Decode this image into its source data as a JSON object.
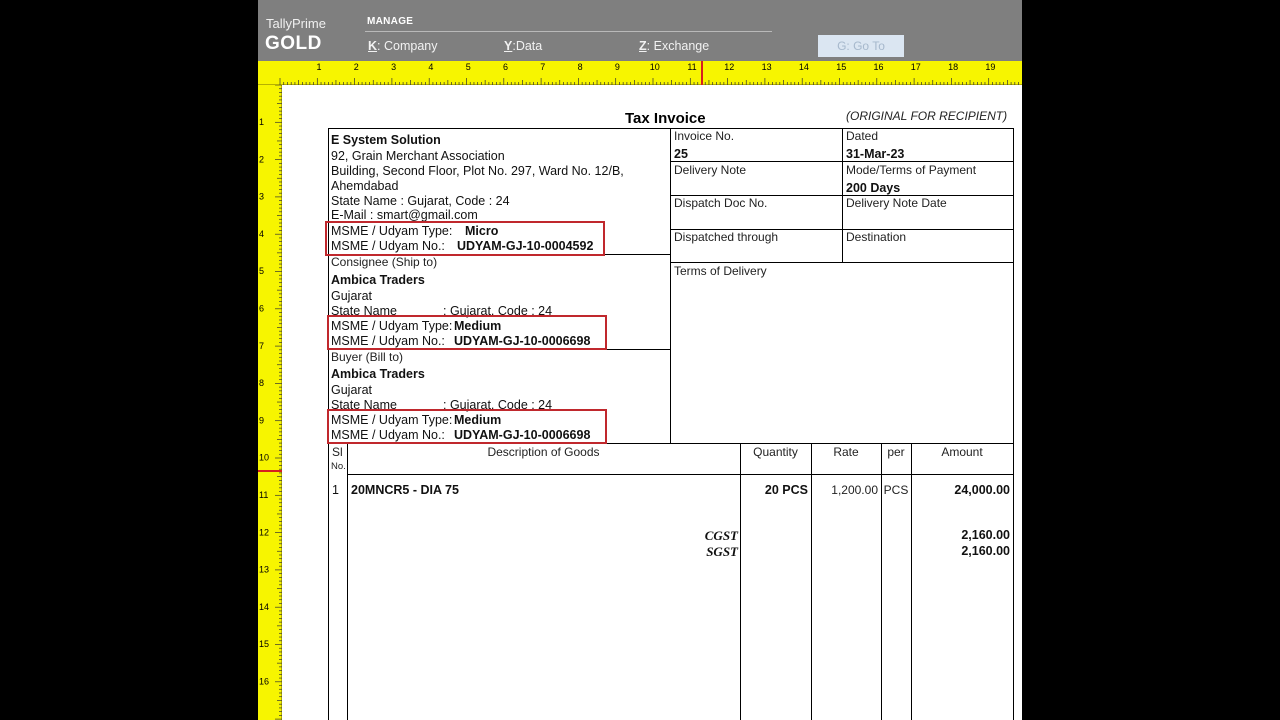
{
  "topbar": {
    "brand_top": "TallyPrime",
    "brand_bottom": "GOLD",
    "section": "MANAGE",
    "menu": [
      {
        "key": "K",
        "label": "Company"
      },
      {
        "key": "Y",
        "label": "Data"
      },
      {
        "key": "Z",
        "label": "Exchange"
      }
    ],
    "goto": "G: Go To"
  },
  "ruler": {
    "h_numbers": [
      "1",
      "2",
      "3",
      "4",
      "5",
      "6",
      "7",
      "8",
      "9",
      "10",
      "11",
      "12",
      "13",
      "14",
      "15",
      "16",
      "17",
      "18",
      "19"
    ],
    "v_numbers": [
      "1",
      "2",
      "3",
      "4",
      "5",
      "6",
      "7",
      "8",
      "9",
      "10",
      "11",
      "12",
      "13",
      "14",
      "15",
      "16"
    ]
  },
  "invoice": {
    "title": "Tax Invoice",
    "copy_label": "(ORIGINAL FOR RECIPIENT)",
    "seller": {
      "name": "E System Solution",
      "addr1": "92, Grain Merchant Association",
      "addr2": "Building, Second Floor, Plot No. 297, Ward No. 12/B,",
      "addr3": "Ahemdabad",
      "state": "State Name :  Gujarat, Code : 24",
      "email": "E-Mail : smart@gmail.com",
      "msme_type_label": "MSME / Udyam Type:",
      "msme_type": "Micro",
      "msme_no_label": "MSME / Udyam No.:",
      "msme_no": "UDYAM-GJ-10-0004592"
    },
    "consignee": {
      "heading": "Consignee (Ship to)",
      "name": "Ambica Traders",
      "addr": "Gujarat",
      "state_label": "State Name",
      "state_value": ":  Gujarat, Code : 24",
      "msme_type_label": "MSME / Udyam Type:",
      "msme_type": "Medium",
      "msme_no_label": "MSME / Udyam No.:",
      "msme_no": "UDYAM-GJ-10-0006698"
    },
    "buyer": {
      "heading": "Buyer (Bill to)",
      "name": "Ambica Traders",
      "addr": "Gujarat",
      "state_label": "State Name",
      "state_value": ":  Gujarat, Code : 24",
      "msme_type_label": "MSME / Udyam Type:",
      "msme_type": "Medium",
      "msme_no_label": "MSME / Udyam No.:",
      "msme_no": "UDYAM-GJ-10-0006698"
    },
    "meta": {
      "invoice_no_label": "Invoice No.",
      "invoice_no": "25",
      "dated_label": "Dated",
      "dated": "31-Mar-23",
      "delivery_note_label": "Delivery Note",
      "terms_payment_label": "Mode/Terms of Payment",
      "terms_payment": "200 Days",
      "dispatch_doc_label": "Dispatch Doc No.",
      "delivery_note_date_label": "Delivery Note Date",
      "dispatched_through_label": "Dispatched through",
      "destination_label": "Destination",
      "terms_delivery_label": "Terms of Delivery"
    },
    "table": {
      "headers": {
        "sl1": "Sl",
        "sl2": "No.",
        "description": "Description of Goods",
        "quantity": "Quantity",
        "rate": "Rate",
        "per": "per",
        "amount": "Amount"
      },
      "rows": [
        {
          "sl": "1",
          "description": "20MNCR5 - DIA 75",
          "quantity": "20 PCS",
          "rate": "1,200.00",
          "per": "PCS",
          "amount": "24,000.00"
        }
      ],
      "taxes": [
        {
          "name": "CGST",
          "amount": "2,160.00"
        },
        {
          "name": "SGST",
          "amount": "2,160.00"
        }
      ]
    }
  }
}
